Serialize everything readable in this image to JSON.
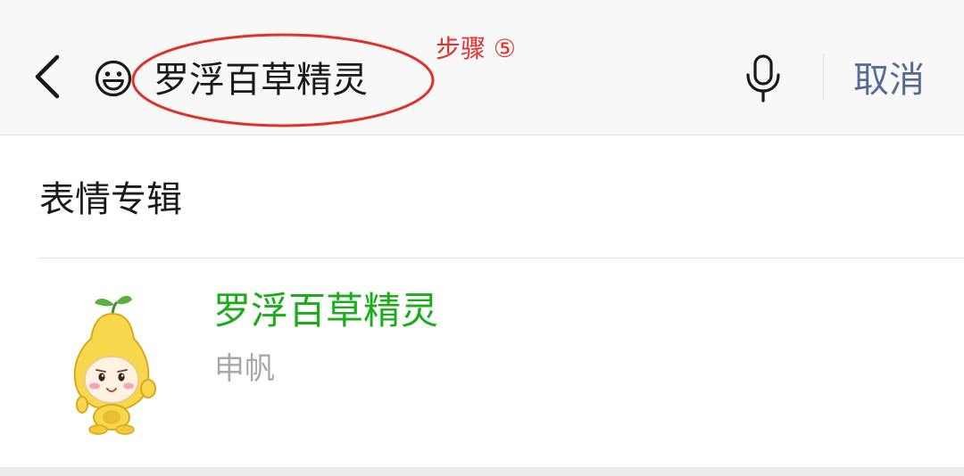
{
  "search": {
    "query": "罗浮百草精灵",
    "cancel_label": "取消"
  },
  "annotation": {
    "step_label": "步骤 ⑤",
    "color": "#e0322b"
  },
  "results": {
    "section_title": "表情专辑",
    "items": [
      {
        "title": "罗浮百草精灵",
        "author": "申帆",
        "thumbnail_icon": "pear-sprite-sticker"
      }
    ]
  },
  "colors": {
    "title_green": "#1aad19",
    "cancel_blue": "#576b95",
    "subtext_gray": "#a8a8a8"
  },
  "icons": {
    "back": "back-chevron-icon",
    "emoji": "smiley-icon",
    "mic": "microphone-icon"
  }
}
